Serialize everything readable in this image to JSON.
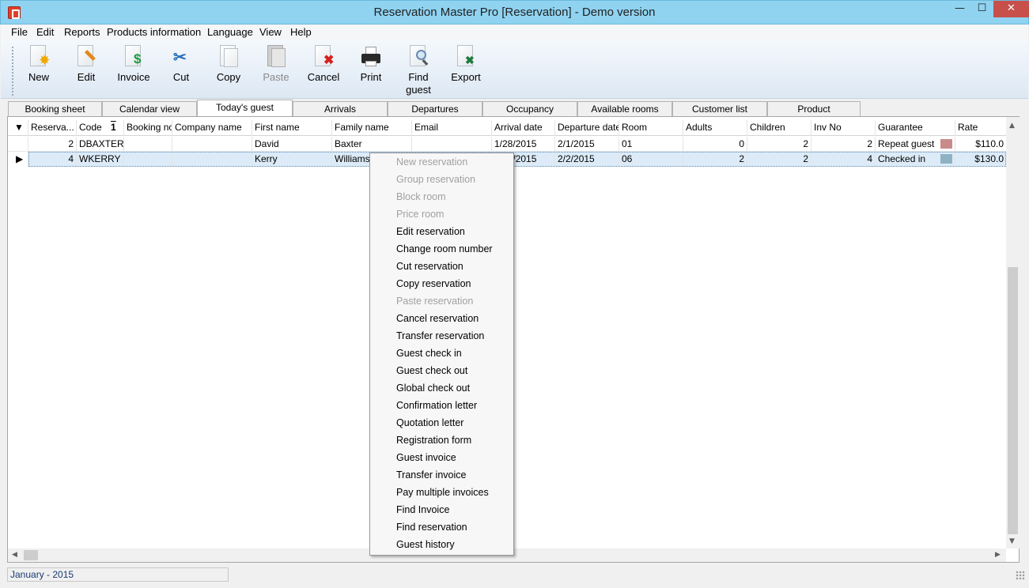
{
  "window": {
    "title": "Reservation Master Pro [Reservation] - Demo version",
    "minimize_glyph": "—",
    "maximize_glyph": "☐",
    "close_glyph": "✕"
  },
  "menu": [
    "File",
    "Edit",
    "Reports",
    "Products information",
    "Language",
    "View",
    "Help"
  ],
  "toolbar": [
    {
      "label": "New",
      "icon": "new-icon",
      "enabled": true
    },
    {
      "label": "Edit",
      "icon": "edit-icon",
      "enabled": true
    },
    {
      "label": "Invoice",
      "icon": "invoice-icon",
      "enabled": true
    },
    {
      "label": "Cut",
      "icon": "cut-icon",
      "enabled": true
    },
    {
      "label": "Copy",
      "icon": "copy-icon",
      "enabled": true
    },
    {
      "label": "Paste",
      "icon": "paste-icon",
      "enabled": false
    },
    {
      "label": "Cancel",
      "icon": "cancel-icon",
      "enabled": true
    },
    {
      "label": "Print",
      "icon": "print-icon",
      "enabled": true
    },
    {
      "label": "Find guest",
      "icon": "find-guest-icon",
      "enabled": true
    },
    {
      "label": "Export",
      "icon": "export-icon",
      "enabled": true
    }
  ],
  "tabs": [
    "Booking sheet",
    "Calendar view",
    "Today's guest",
    "Arrivals",
    "Departures",
    "Occupancy",
    "Available rooms",
    "Customer list",
    "Product"
  ],
  "active_tab": "Today's guest",
  "grid": {
    "columns": [
      "Reserva...",
      "Code",
      "Booking no",
      "Company name",
      "First name",
      "Family name",
      "Email",
      "Arrival date",
      "Departure date",
      "Room",
      "Adults",
      "Children",
      "Inv No",
      "Guarantee",
      "Rate"
    ],
    "sort_indicator": "1",
    "rows": [
      {
        "reservation": "2",
        "code": "DBAXTER",
        "booking_no": "",
        "company": "",
        "first_name": "David",
        "family_name": "Baxter",
        "email": "",
        "arrival": "1/28/2015",
        "departure": "2/1/2015",
        "room": "01",
        "adults": "0",
        "children": "2",
        "inv_no": "2",
        "guarantee": "Repeat guest",
        "guarantee_color": "#c98a8a",
        "rate": "$110.0"
      },
      {
        "reservation": "4",
        "code": "WKERRY",
        "booking_no": "",
        "company": "",
        "first_name": "Kerry",
        "family_name": "Williams",
        "email": "",
        "arrival": "1/29/2015",
        "departure": "2/2/2015",
        "room": "06",
        "adults": "2",
        "children": "2",
        "inv_no": "4",
        "guarantee": "Checked in",
        "guarantee_color": "#8eb2c4",
        "rate": "$130.0"
      }
    ]
  },
  "context_menu": [
    {
      "label": "New reservation",
      "enabled": false
    },
    {
      "label": "Group reservation",
      "enabled": false
    },
    {
      "label": "Block room",
      "enabled": false
    },
    {
      "label": "Price room",
      "enabled": false
    },
    {
      "label": "Edit reservation",
      "enabled": true
    },
    {
      "label": "Change room number",
      "enabled": true
    },
    {
      "label": "Cut reservation",
      "enabled": true
    },
    {
      "label": "Copy reservation",
      "enabled": true
    },
    {
      "label": "Paste reservation",
      "enabled": false
    },
    {
      "label": "Cancel reservation",
      "enabled": true
    },
    {
      "label": "Transfer reservation",
      "enabled": true
    },
    {
      "label": "Guest check in",
      "enabled": true
    },
    {
      "label": "Guest check out",
      "enabled": true
    },
    {
      "label": "Global check out",
      "enabled": true
    },
    {
      "label": "Confirmation letter",
      "enabled": true
    },
    {
      "label": "Quotation letter",
      "enabled": true
    },
    {
      "label": "Registration form",
      "enabled": true
    },
    {
      "label": "Guest invoice",
      "enabled": true
    },
    {
      "label": "Transfer invoice",
      "enabled": true
    },
    {
      "label": "Pay multiple invoices",
      "enabled": true
    },
    {
      "label": "Find Invoice",
      "enabled": true
    },
    {
      "label": "Find reservation",
      "enabled": true
    },
    {
      "label": "Guest history",
      "enabled": true
    }
  ],
  "status": {
    "text": "January - 2015"
  }
}
